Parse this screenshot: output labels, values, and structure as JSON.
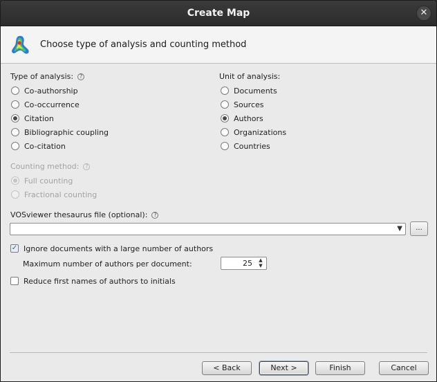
{
  "window": {
    "title": "Create Map",
    "close_glyph": "✕"
  },
  "header": {
    "heading": "Choose type of analysis and counting method",
    "logo_icon": "vosviewer-logo-icon"
  },
  "type_of_analysis": {
    "label": "Type of analysis:",
    "options": [
      "Co-authorship",
      "Co-occurrence",
      "Citation",
      "Bibliographic coupling",
      "Co-citation"
    ],
    "selected": "Citation"
  },
  "unit_of_analysis": {
    "label": "Unit of analysis:",
    "options": [
      "Documents",
      "Sources",
      "Authors",
      "Organizations",
      "Countries"
    ],
    "selected": "Authors"
  },
  "counting_method": {
    "label": "Counting method:",
    "options": [
      "Full counting",
      "Fractional counting"
    ],
    "selected": "Full counting",
    "enabled": false
  },
  "thesaurus": {
    "label": "VOSviewer thesaurus file (optional):",
    "value": "",
    "browse_label": "..."
  },
  "ignore_large": {
    "label": "Ignore documents with a large number of authors",
    "checked": true
  },
  "max_authors": {
    "label": "Maximum number of authors per document:",
    "value": "25"
  },
  "reduce_names": {
    "label": "Reduce first names of authors to initials",
    "checked": false
  },
  "buttons": {
    "back": "< Back",
    "next": "Next >",
    "finish": "Finish",
    "cancel": "Cancel"
  },
  "help_glyph": "?"
}
